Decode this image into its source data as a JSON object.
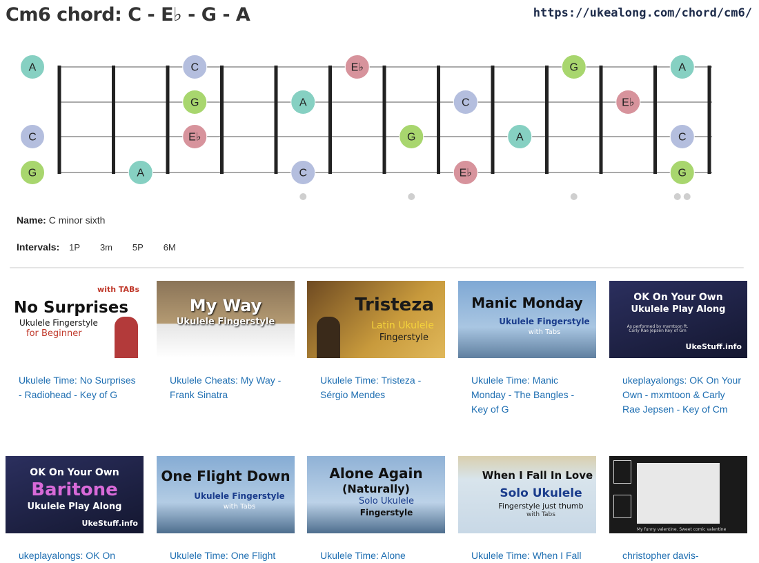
{
  "title": "Cm6 chord: C - E♭ - G - A",
  "url": "https://ukealong.com/chord/cm6/",
  "chart_data": {
    "strings": 4,
    "frets": 12,
    "note_colors": {
      "A": "#86d0c2",
      "C": "#b4bede",
      "E♭": "#d7939c",
      "G": "#a8d66e"
    },
    "open_notes": [
      "A",
      "",
      "C",
      "G"
    ],
    "fretted": [
      {
        "string": 0,
        "fret": 3,
        "note": "C"
      },
      {
        "string": 0,
        "fret": 6,
        "note": "E♭"
      },
      {
        "string": 0,
        "fret": 10,
        "note": "G"
      },
      {
        "string": 0,
        "fret": 12,
        "note": "A"
      },
      {
        "string": 1,
        "fret": 3,
        "note": "G"
      },
      {
        "string": 1,
        "fret": 5,
        "note": "A"
      },
      {
        "string": 1,
        "fret": 8,
        "note": "C"
      },
      {
        "string": 1,
        "fret": 11,
        "note": "E♭"
      },
      {
        "string": 2,
        "fret": 3,
        "note": "E♭"
      },
      {
        "string": 2,
        "fret": 7,
        "note": "G"
      },
      {
        "string": 2,
        "fret": 9,
        "note": "A"
      },
      {
        "string": 2,
        "fret": 12,
        "note": "C"
      },
      {
        "string": 3,
        "fret": 2,
        "note": "A"
      },
      {
        "string": 3,
        "fret": 5,
        "note": "C"
      },
      {
        "string": 3,
        "fret": 8,
        "note": "E♭"
      },
      {
        "string": 3,
        "fret": 12,
        "note": "G"
      }
    ],
    "fret_markers": [
      5,
      7,
      10,
      12
    ]
  },
  "chord_info": {
    "name_label": "Name:",
    "name_value": "C minor sixth",
    "intervals_label": "Intervals:",
    "intervals": [
      "1P",
      "3m",
      "5P",
      "6M"
    ]
  },
  "videos": [
    {
      "link": "Ukulele Time: No Surprises - Radiohead - Key of G",
      "thumb_lines": [
        "No Surprises",
        "with TABs",
        "Ukulele Fingerstyle",
        "for Beginner"
      ],
      "bg": "#ffffff"
    },
    {
      "link": "Ukulele Cheats: My Way - Frank Sinatra",
      "thumb_lines": [
        "My Way",
        "Ukulele Fingerstyle"
      ],
      "bg": "#8a7458"
    },
    {
      "link": "Ukulele Time: Tristeza - Sérgio Mendes",
      "thumb_lines": [
        "Tristeza",
        "Latin Ukulele",
        "Fingerstyle"
      ],
      "bg": "#c89a3c"
    },
    {
      "link": "Ukulele Time: Manic Monday - The Bangles - Key of G",
      "thumb_lines": [
        "Manic Monday",
        "Ukulele Fingerstyle",
        "with Tabs"
      ],
      "bg": "#7fa8d4"
    },
    {
      "link": "ukeplayalongs: OK On Your Own - mxmtoon & Carly Rae Jepsen - Key of Cm",
      "thumb_lines": [
        "OK On Your Own",
        "Ukulele Play Along",
        "As performed by mxmtoon ft. Carly Rae Jepsen Key of Gm",
        "UkeStuff.info"
      ],
      "bg": "#1e2346"
    },
    {
      "link": "ukeplayalongs: OK On",
      "thumb_lines": [
        "OK On Your Own",
        "Baritone",
        "Ukulele Play Along",
        "UkeStuff.info"
      ],
      "bg": "#1e2346"
    },
    {
      "link": "Ukulele Time: One Flight",
      "thumb_lines": [
        "One Flight Down",
        "Ukulele Fingerstyle",
        "with Tabs"
      ],
      "bg": "#86acd4"
    },
    {
      "link": "Ukulele Time: Alone",
      "thumb_lines": [
        "Alone Again",
        "(Naturally)",
        "Solo Ukulele",
        "Fingerstyle"
      ],
      "bg": "#90b2d6"
    },
    {
      "link": "Ukulele Time: When I Fall",
      "thumb_lines": [
        "When I Fall In Love",
        "Solo Ukulele",
        "Fingerstyle just thumb",
        "with Tabs"
      ],
      "bg": "#d8e4ec"
    },
    {
      "link": "christopher davis-",
      "thumb_lines": [
        "My funny valentine. Sweet comic valentine"
      ],
      "bg": "#1a1a1a"
    }
  ]
}
